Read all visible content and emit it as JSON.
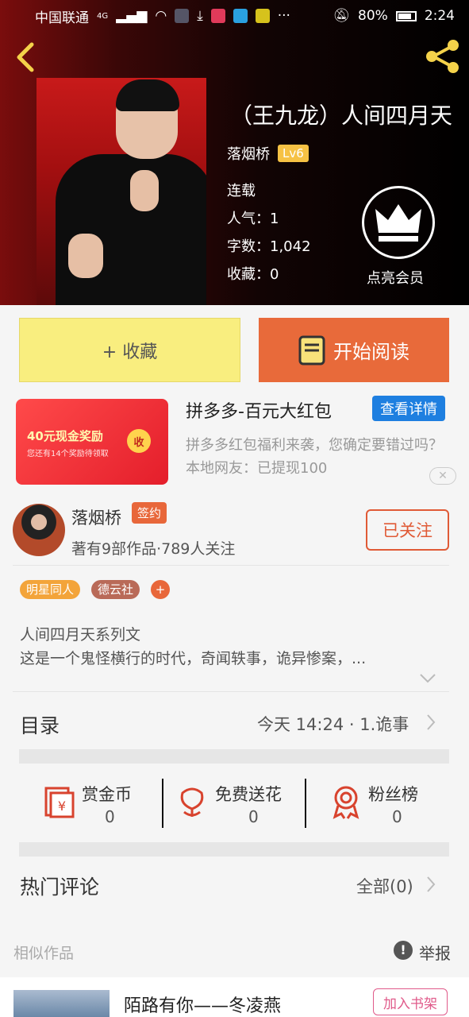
{
  "status_bar": {
    "carrier": "中国联通",
    "network": "4G",
    "battery": "80%",
    "time": "2:24"
  },
  "book": {
    "title": "（王九龙）人间四月天",
    "author": "落烟桥",
    "level": "Lv6",
    "status": "连载",
    "popularity": "人气：1",
    "word_count": "字数：1,042",
    "favorites": "收藏：0",
    "vip_label": "点亮会员"
  },
  "actions": {
    "favorite": "+ 收藏",
    "read": "开始阅读"
  },
  "ad": {
    "image_big": "40元现金奖励",
    "image_small": "您还有14个奖励待领取",
    "image_coin": "收",
    "title": "拼多多-百元大红包",
    "detail_button": "查看详情",
    "desc": "拼多多红包福利来袭，您确定要错过吗？本地网友：已提现100",
    "close": "✕"
  },
  "author_card": {
    "name": "落烟桥",
    "badge": "签约",
    "sub": "著有9部作品·789人关注",
    "follow_button": "已关注"
  },
  "tags": [
    "明星同人",
    "德云社",
    "+"
  ],
  "description": {
    "line1": "人间四月天系列文",
    "line2": "这是一个鬼怪横行的时代，奇闻轶事，诡异惨案，..."
  },
  "toc": {
    "label": "目录",
    "latest": "今天 14:24 · 1.诡事"
  },
  "stats": [
    {
      "label": "赏金币",
      "value": "0",
      "icon": "red-envelope-icon"
    },
    {
      "label": "免费送花",
      "value": "0",
      "icon": "flower-icon"
    },
    {
      "label": "粉丝榜",
      "value": "0",
      "icon": "medal-icon"
    }
  ],
  "comments": {
    "label": "热门评论",
    "all": "全部(0)"
  },
  "similar": {
    "label": "相似作品",
    "report": "举报",
    "report_icon": "!"
  },
  "similar_item": {
    "title": "陌路有你——冬凌燕",
    "add_button": "加入书架"
  },
  "colors": {
    "accent": "#e86a3a",
    "fav": "#f9ee7f",
    "link": "#1e7fe0",
    "gold": "#f6c244"
  }
}
